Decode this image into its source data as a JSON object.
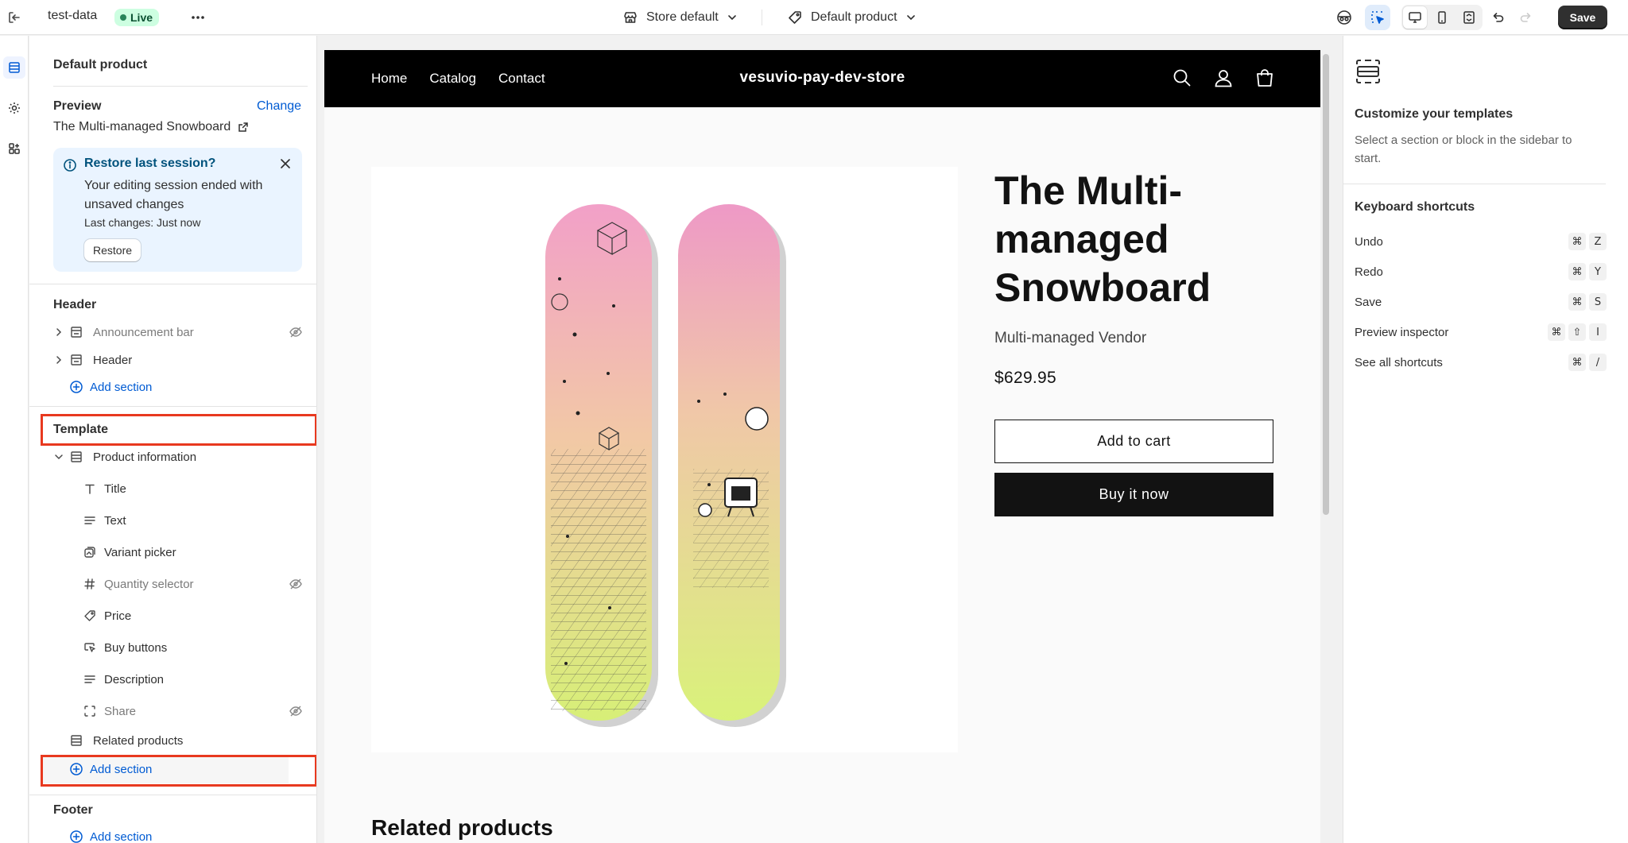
{
  "topbar": {
    "theme_name": "test-data",
    "status_badge": "Live",
    "store_selector": "Store default",
    "template_selector": "Default product",
    "save_label": "Save"
  },
  "sidebar": {
    "title": "Default product",
    "preview_label": "Preview",
    "change_label": "Change",
    "preview_product": "The Multi-managed Snowboard",
    "restore_banner": {
      "title": "Restore last session?",
      "body": "Your editing session ended with unsaved changes",
      "last_changes": "Last changes: Just now",
      "restore_label": "Restore"
    },
    "header_group": {
      "title": "Header",
      "items": [
        {
          "label": "Announcement bar",
          "hidden": true
        },
        {
          "label": "Header",
          "hidden": false
        }
      ],
      "add_label": "Add section"
    },
    "template_group": {
      "title": "Template",
      "section_label": "Product information",
      "blocks": [
        {
          "label": "Title",
          "icon": "title-icon",
          "hidden": false
        },
        {
          "label": "Text",
          "icon": "text-lines-icon",
          "hidden": false
        },
        {
          "label": "Variant picker",
          "icon": "variant-icon",
          "hidden": false
        },
        {
          "label": "Quantity selector",
          "icon": "hash-icon",
          "hidden": true
        },
        {
          "label": "Price",
          "icon": "price-tag-icon",
          "hidden": false
        },
        {
          "label": "Buy buttons",
          "icon": "cursor-button-icon",
          "hidden": false
        },
        {
          "label": "Description",
          "icon": "text-lines-icon",
          "hidden": false
        },
        {
          "label": "Share",
          "icon": "share-frame-icon",
          "hidden": true
        }
      ],
      "related_label": "Related products",
      "add_label": "Add section"
    },
    "footer_group": {
      "title": "Footer",
      "add_label": "Add section"
    }
  },
  "store": {
    "nav": [
      "Home",
      "Catalog",
      "Contact"
    ],
    "name": "vesuvio-pay-dev-store",
    "product_title": "The Multi-managed Snowboard",
    "vendor": "Multi-managed Vendor",
    "price": "$629.95",
    "add_to_cart": "Add to cart",
    "buy_now": "Buy it now",
    "related_heading": "Related products"
  },
  "right_panel": {
    "title": "Customize your templates",
    "description": "Select a section or block in the sidebar to start.",
    "shortcuts_title": "Keyboard shortcuts",
    "shortcuts": [
      {
        "label": "Undo",
        "keys": [
          "⌘",
          "Z"
        ]
      },
      {
        "label": "Redo",
        "keys": [
          "⌘",
          "Y"
        ]
      },
      {
        "label": "Save",
        "keys": [
          "⌘",
          "S"
        ]
      },
      {
        "label": "Preview inspector",
        "keys": [
          "⌘",
          "⇧",
          "I"
        ]
      },
      {
        "label": "See all shortcuts",
        "keys": [
          "⌘",
          "/"
        ]
      }
    ]
  },
  "colors": {
    "accent": "#005bd3",
    "highlight": "#e8391f",
    "live_green": "#29845a"
  }
}
